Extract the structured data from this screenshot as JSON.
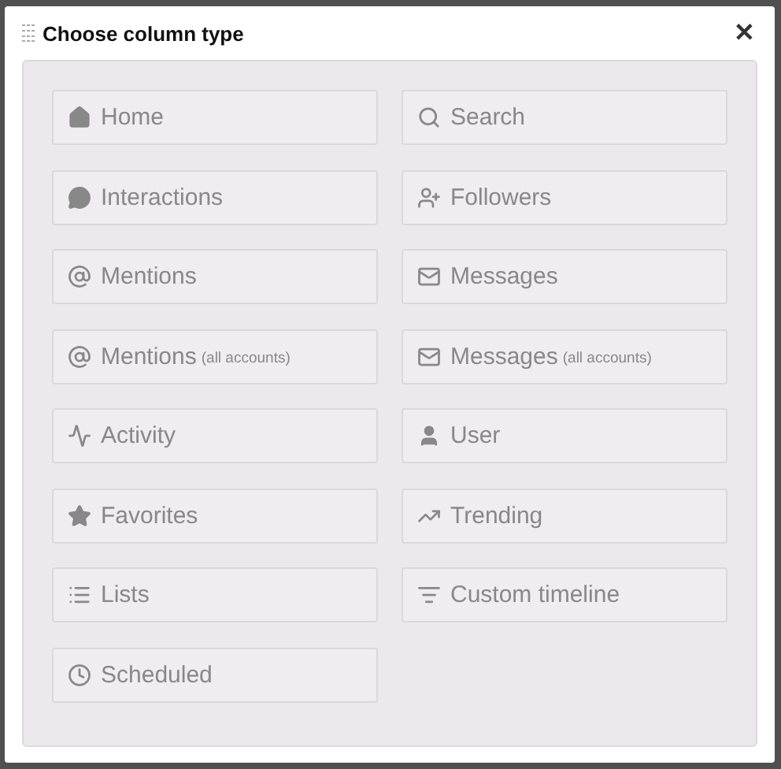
{
  "dialog": {
    "title": "Choose column type",
    "close": "✕"
  },
  "options": [
    {
      "label": "Home",
      "kind": "home"
    },
    {
      "label": "Search",
      "kind": "search"
    },
    {
      "label": "Interactions",
      "kind": "comment"
    },
    {
      "label": "Followers",
      "kind": "follow"
    },
    {
      "label": "Mentions",
      "kind": "at"
    },
    {
      "label": "Messages",
      "kind": "mail"
    },
    {
      "label": "Mentions",
      "note": "(all accounts)",
      "kind": "at"
    },
    {
      "label": "Messages",
      "note": "(all accounts)",
      "kind": "mail"
    },
    {
      "label": "Activity",
      "kind": "pulse"
    },
    {
      "label": "User",
      "kind": "user"
    },
    {
      "label": "Favorites",
      "kind": "star"
    },
    {
      "label": "Trending",
      "kind": "trend"
    },
    {
      "label": "Lists",
      "kind": "list"
    },
    {
      "label": "Custom timeline",
      "kind": "filter"
    },
    {
      "label": "Scheduled",
      "kind": "clock"
    }
  ]
}
